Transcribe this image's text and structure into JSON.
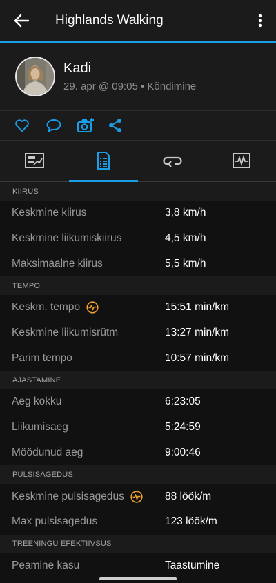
{
  "appbar": {
    "title": "Highlands Walking"
  },
  "profile": {
    "name": "Kadi",
    "subtitle": "29. apr @ 09:05 • Kõndimine"
  },
  "colors": {
    "accent": "#1c9ee6",
    "hr_accent": "#f0a030"
  },
  "actions": [
    "heart-icon",
    "comment-icon",
    "add-photo-icon",
    "share-icon"
  ],
  "tabs": [
    "overview-icon",
    "stats-icon",
    "laps-icon",
    "charts-icon"
  ],
  "sections": [
    {
      "title": "KIIRUS",
      "rows": [
        {
          "label": "Keskmine kiirus",
          "value": "3,8 km/h"
        },
        {
          "label": "Keskmine liikumiskiirus",
          "value": "4,5 km/h"
        },
        {
          "label": "Maksimaalne kiirus",
          "value": "5,5 km/h"
        }
      ]
    },
    {
      "title": "TEMPO",
      "rows": [
        {
          "label": "Keskm. tempo",
          "value": "15:51 min/km",
          "icon": "heart-rate-icon"
        },
        {
          "label": "Keskmine liikumisrütm",
          "value": "13:27 min/km"
        },
        {
          "label": "Parim tempo",
          "value": "10:57 min/km"
        }
      ]
    },
    {
      "title": "AJASTAMINE",
      "rows": [
        {
          "label": "Aeg kokku",
          "value": "6:23:05"
        },
        {
          "label": "Liikumisaeg",
          "value": "5:24:59"
        },
        {
          "label": "Möödunud aeg",
          "value": "9:00:46"
        }
      ]
    },
    {
      "title": "PULSISAGEDUS",
      "rows": [
        {
          "label": "Keskmine pulsisagedus",
          "value": "88 löök/m",
          "icon": "heart-rate-icon"
        },
        {
          "label": "Max pulsisagedus",
          "value": "123 löök/m"
        }
      ]
    },
    {
      "title": "TREENINGU EFEKTIIVSUS",
      "rows": [
        {
          "label": "Peamine kasu",
          "value": "Taastumine"
        }
      ]
    }
  ]
}
